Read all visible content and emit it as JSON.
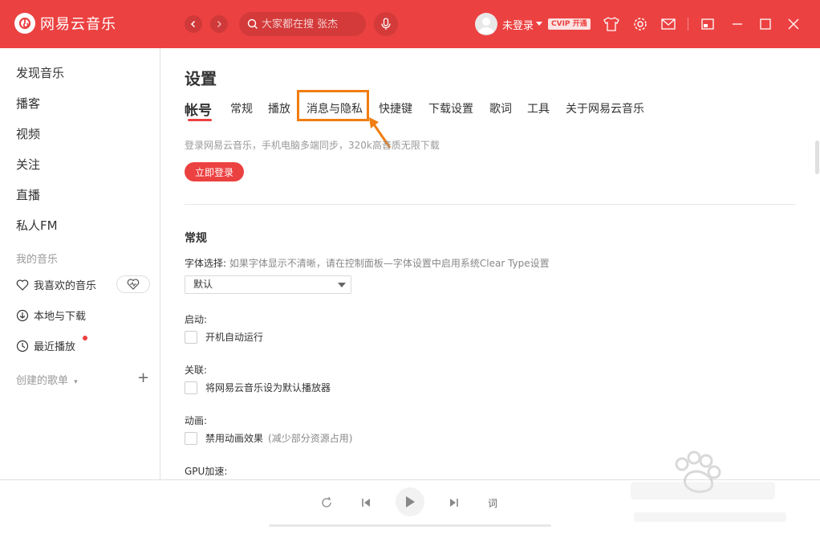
{
  "app": {
    "title": "网易云音乐",
    "accent_color": "#ec4141"
  },
  "topbar": {
    "back_icon": "chevron-left-icon",
    "forward_icon": "chevron-right-icon",
    "search": {
      "placeholder": "大家都在搜 张杰",
      "icon": "search-icon"
    },
    "mic_icon": "microphone-icon",
    "user": {
      "name": "未登录",
      "vip_label": "CVIP 开通"
    },
    "icons": [
      "tshirt-icon",
      "gear-icon",
      "mail-icon",
      "mini-mode-icon",
      "minimize-icon",
      "maximize-icon",
      "close-icon"
    ]
  },
  "sidebar": {
    "items": [
      "发现音乐",
      "播客",
      "视频",
      "关注",
      "直播",
      "私人FM"
    ],
    "my_music_label": "我的音乐",
    "my_music": [
      {
        "label": "我喜欢的音乐",
        "icon": "heart-icon"
      },
      {
        "label": "本地与下载",
        "icon": "download-icon"
      },
      {
        "label": "最近播放",
        "icon": "clock-icon"
      }
    ],
    "created_playlists_label": "创建的歌单",
    "add_label": "+"
  },
  "settings": {
    "title": "设置",
    "tabs": [
      "帐号",
      "常规",
      "播放",
      "消息与隐私",
      "快捷键",
      "下载设置",
      "歌词",
      "工具",
      "关于网易云音乐"
    ],
    "active_tab": "帐号",
    "highlighted_tab": "消息与隐私",
    "account": {
      "description": "登录网易云音乐，手机电脑多端同步，320k高音质无限下载",
      "login_button": "立即登录"
    },
    "general": {
      "title": "常规",
      "font_label": "字体选择:",
      "font_hint": "如果字体显示不清晰，请在控制面板—字体设置中启用系统Clear Type设置",
      "font_value": "默认",
      "startup_label": "启动:",
      "startup_option": "开机自动运行",
      "assoc_label": "关联:",
      "assoc_option": "将网易云音乐设为默认播放器",
      "anim_label": "动画:",
      "anim_option": "禁用动画效果",
      "anim_hint": "(减少部分资源占用)",
      "gpu_label": "GPU加速:"
    }
  },
  "player": {
    "icons": [
      "loop-icon",
      "previous-icon",
      "play-icon",
      "next-icon"
    ],
    "lyric_label": "词"
  }
}
